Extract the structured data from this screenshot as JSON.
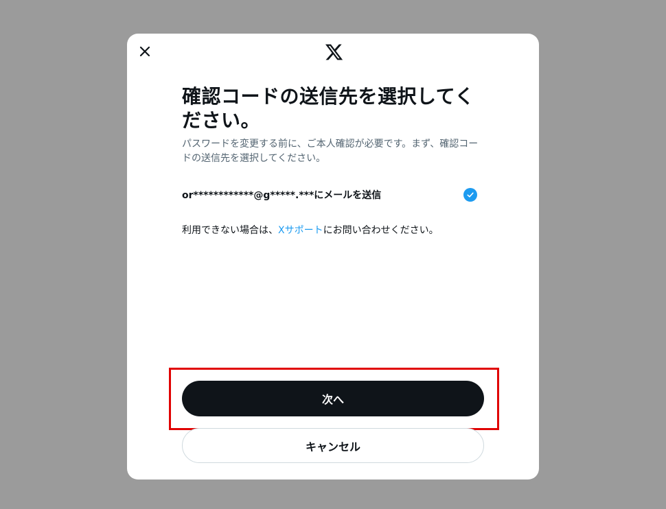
{
  "dialog": {
    "title": "確認コードの送信先を選択してください。",
    "subtitle": "パスワードを変更する前に、ご本人確認が必要です。まず、確認コードの送信先を選択してください。",
    "option": {
      "label": "or************@g*****.***にメールを送信",
      "selected": true
    },
    "help": {
      "prefix": "利用できない場合は、",
      "link": "Xサポート",
      "suffix": "にお問い合わせください。"
    },
    "next_label": "次へ",
    "cancel_label": "キャンセル"
  },
  "icons": {
    "close": "close-icon",
    "logo": "x-logo-icon",
    "check": "check-circle-icon"
  },
  "colors": {
    "overlay": "#9b9b9b",
    "primary_text": "#0f1419",
    "secondary_text": "#536471",
    "accent": "#1d9bf0",
    "highlight_border": "#e00000"
  }
}
